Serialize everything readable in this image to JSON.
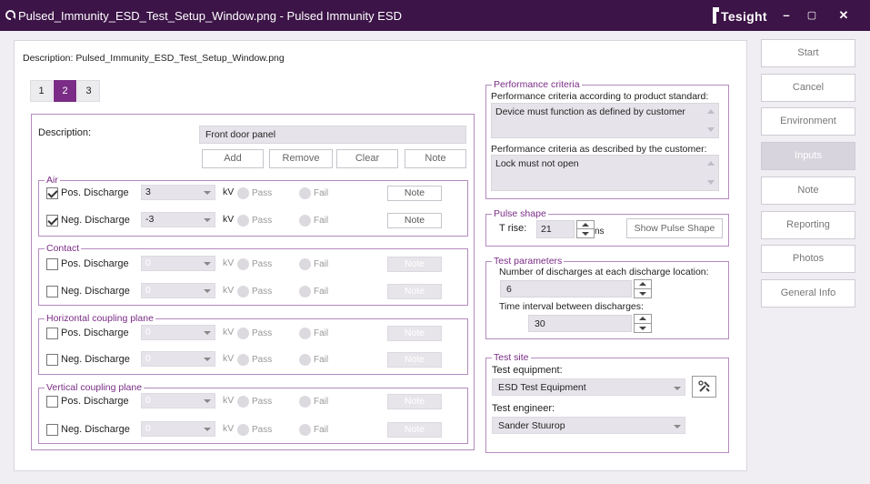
{
  "window": {
    "title": "Pulsed_Immunity_ESD_Test_Setup_Window.png - Pulsed Immunity ESD",
    "logo_text": "Tesight",
    "minimize": "–",
    "maximize": "▢",
    "close": "✕"
  },
  "main": {
    "description_line": "Description: Pulsed_Immunity_ESD_Test_Setup_Window.png",
    "tabs": [
      "1",
      "2",
      "3"
    ],
    "active_tab": "2",
    "description_label": "Description:",
    "description_value": "Front door panel",
    "buttons": {
      "add": "Add",
      "remove": "Remove",
      "clear": "Clear",
      "note": "Note"
    },
    "groups": [
      {
        "title": "Air",
        "rows": [
          {
            "label": "Pos. Discharge",
            "checked": true,
            "value": "3",
            "unit": "kV",
            "pass": "Pass",
            "fail": "Fail",
            "note": "Note",
            "enabled": true
          },
          {
            "label": "Neg. Discharge",
            "checked": true,
            "value": "-3",
            "unit": "kV",
            "pass": "Pass",
            "fail": "Fail",
            "note": "Note",
            "enabled": true
          }
        ]
      },
      {
        "title": "Contact",
        "rows": [
          {
            "label": "Pos. Discharge",
            "checked": false,
            "value": "0",
            "unit": "kV",
            "pass": "Pass",
            "fail": "Fail",
            "note": "Note",
            "enabled": false
          },
          {
            "label": "Neg. Discharge",
            "checked": false,
            "value": "0",
            "unit": "kV",
            "pass": "Pass",
            "fail": "Fail",
            "note": "Note",
            "enabled": false
          }
        ]
      },
      {
        "title": "Horizontal coupling plane",
        "rows": [
          {
            "label": "Pos. Discharge",
            "checked": false,
            "value": "0",
            "unit": "kV",
            "pass": "Pass",
            "fail": "Fail",
            "note": "Note",
            "enabled": false
          },
          {
            "label": "Neg. Discharge",
            "checked": false,
            "value": "0",
            "unit": "kV",
            "pass": "Pass",
            "fail": "Fail",
            "note": "Note",
            "enabled": false
          }
        ]
      },
      {
        "title": "Vertical coupling plane",
        "rows": [
          {
            "label": "Pos. Discharge",
            "checked": false,
            "value": "0",
            "unit": "kV",
            "pass": "Pass",
            "fail": "Fail",
            "note": "Note",
            "enabled": false
          },
          {
            "label": "Neg. Discharge",
            "checked": false,
            "value": "0",
            "unit": "kV",
            "pass": "Pass",
            "fail": "Fail",
            "note": "Note",
            "enabled": false
          }
        ]
      }
    ]
  },
  "performance": {
    "title": "Performance criteria",
    "standard_label": "Performance criteria according to product standard:",
    "standard_value": "Device must function as defined by customer",
    "customer_label": "Performance criteria as described by the customer:",
    "customer_value": "Lock must not open"
  },
  "pulse": {
    "title": "Pulse shape",
    "trise_label": "T rise:",
    "trise_value": "21",
    "trise_unit": "ns",
    "show_button": "Show Pulse Shape"
  },
  "params": {
    "title": "Test parameters",
    "discharges_label": "Number of discharges at each discharge location:",
    "discharges_value": "6",
    "interval_label": "Time interval between discharges:",
    "interval_value": "30"
  },
  "site": {
    "title": "Test site",
    "equipment_label": "Test equipment:",
    "equipment_value": "ESD Test Equipment",
    "engineer_label": "Test engineer:",
    "engineer_value": "Sander Stuurop"
  },
  "sidebar": {
    "active": "Inputs",
    "items": [
      "Start",
      "Cancel",
      "Environment",
      "Inputs",
      "Note",
      "Reporting",
      "Photos",
      "General Info"
    ]
  },
  "colors": {
    "titlebar": "#3c1447",
    "accent": "#7a2c86",
    "group_border": "#b58abf"
  }
}
